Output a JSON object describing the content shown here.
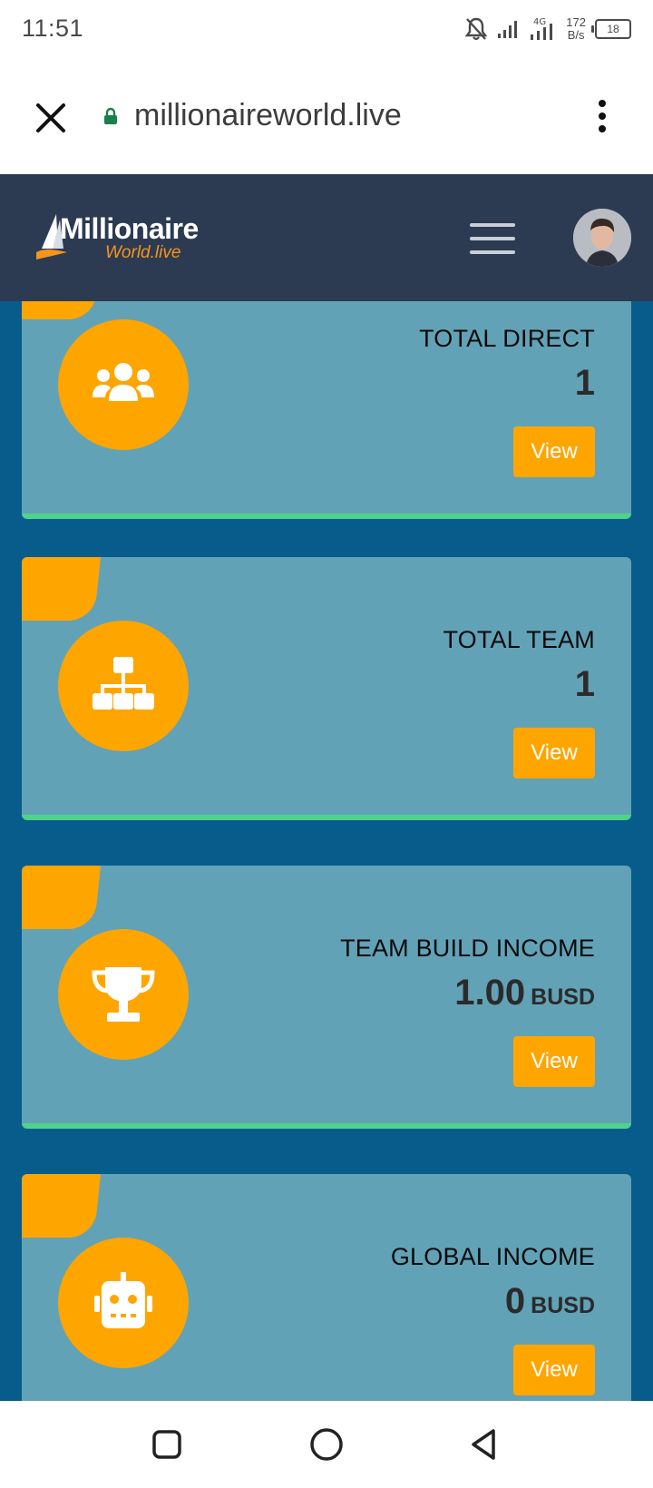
{
  "status": {
    "time": "11:51",
    "net_speed_value": "172",
    "net_speed_unit": "B/s",
    "battery": "18"
  },
  "browser": {
    "url": "millionaireworld.live"
  },
  "site": {
    "logo_main": "Millionaire",
    "logo_sub": "World.live"
  },
  "cards": [
    {
      "title": "TOTAL DIRECT",
      "value": "1",
      "unit": "",
      "button": "View",
      "icon": "users-icon"
    },
    {
      "title": "TOTAL TEAM",
      "value": "1",
      "unit": "",
      "button": "View",
      "icon": "sitemap-icon"
    },
    {
      "title": "TEAM BUILD INCOME",
      "value": "1.00",
      "unit": "BUSD",
      "button": "View",
      "icon": "trophy-icon"
    },
    {
      "title": "GLOBAL INCOME",
      "value": "0",
      "unit": "BUSD",
      "button": "View",
      "icon": "robot-icon"
    }
  ],
  "colors": {
    "header_bg": "#2c3b52",
    "content_bg": "#075c8c",
    "card_bg": "#62a2b7",
    "accent": "#ffa500",
    "card_border": "#4fd389"
  }
}
